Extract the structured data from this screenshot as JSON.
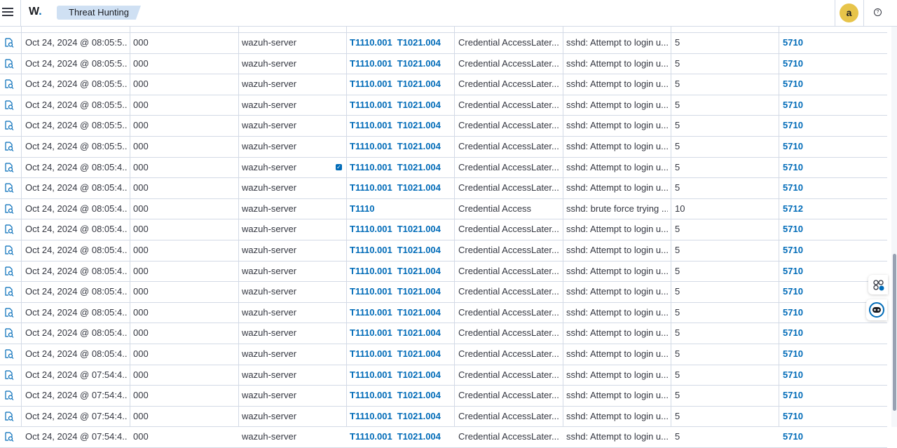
{
  "header": {
    "logo_text": "W",
    "logo_dot": ".",
    "breadcrumb": "Threat Hunting",
    "avatar_initial": "a",
    "help_symbol": "?"
  },
  "colors": {
    "link": "#006bb8",
    "avatar": "#e7c44a",
    "breadcrumb_bg": "#cfe0f3"
  },
  "table": {
    "rows": [
      {
        "time": "Oct 24, 2024 @ 08:05:5...",
        "agent": "000",
        "name": "wazuh-server",
        "techniques": [
          "T1110.001",
          "T1021.004"
        ],
        "tactic": "Credential AccessLater...",
        "description": "sshd: Attempt to login u...",
        "level": "5",
        "rule": "5710"
      },
      {
        "time": "Oct 24, 2024 @ 08:05:5...",
        "agent": "000",
        "name": "wazuh-server",
        "techniques": [
          "T1110.001",
          "T1021.004"
        ],
        "tactic": "Credential AccessLater...",
        "description": "sshd: Attempt to login u...",
        "level": "5",
        "rule": "5710"
      },
      {
        "time": "Oct 24, 2024 @ 08:05:5...",
        "agent": "000",
        "name": "wazuh-server",
        "techniques": [
          "T1110.001",
          "T1021.004"
        ],
        "tactic": "Credential AccessLater...",
        "description": "sshd: Attempt to login u...",
        "level": "5",
        "rule": "5710"
      },
      {
        "time": "Oct 24, 2024 @ 08:05:5...",
        "agent": "000",
        "name": "wazuh-server",
        "techniques": [
          "T1110.001",
          "T1021.004"
        ],
        "tactic": "Credential AccessLater...",
        "description": "sshd: Attempt to login u...",
        "level": "5",
        "rule": "5710"
      },
      {
        "time": "Oct 24, 2024 @ 08:05:5...",
        "agent": "000",
        "name": "wazuh-server",
        "techniques": [
          "T1110.001",
          "T1021.004"
        ],
        "tactic": "Credential AccessLater...",
        "description": "sshd: Attempt to login u...",
        "level": "5",
        "rule": "5710"
      },
      {
        "time": "Oct 24, 2024 @ 08:05:5...",
        "agent": "000",
        "name": "wazuh-server",
        "techniques": [
          "T1110.001",
          "T1021.004"
        ],
        "tactic": "Credential AccessLater...",
        "description": "sshd: Attempt to login u...",
        "level": "5",
        "rule": "5710"
      },
      {
        "time": "Oct 24, 2024 @ 08:05:4...",
        "agent": "000",
        "name": "wazuh-server",
        "techniques": [
          "T1110.001",
          "T1021.004"
        ],
        "tactic": "Credential AccessLater...",
        "description": "sshd: Attempt to login u...",
        "level": "5",
        "rule": "5710",
        "checked": true
      },
      {
        "time": "Oct 24, 2024 @ 08:05:4...",
        "agent": "000",
        "name": "wazuh-server",
        "techniques": [
          "T1110.001",
          "T1021.004"
        ],
        "tactic": "Credential AccessLater...",
        "description": "sshd: Attempt to login u...",
        "level": "5",
        "rule": "5710"
      },
      {
        "time": "Oct 24, 2024 @ 08:05:4...",
        "agent": "000",
        "name": "wazuh-server",
        "techniques": [
          "T1110"
        ],
        "tactic": "Credential Access",
        "description": "sshd: brute force trying ...",
        "level": "10",
        "rule": "5712"
      },
      {
        "time": "Oct 24, 2024 @ 08:05:4...",
        "agent": "000",
        "name": "wazuh-server",
        "techniques": [
          "T1110.001",
          "T1021.004"
        ],
        "tactic": "Credential AccessLater...",
        "description": "sshd: Attempt to login u...",
        "level": "5",
        "rule": "5710"
      },
      {
        "time": "Oct 24, 2024 @ 08:05:4...",
        "agent": "000",
        "name": "wazuh-server",
        "techniques": [
          "T1110.001",
          "T1021.004"
        ],
        "tactic": "Credential AccessLater...",
        "description": "sshd: Attempt to login u...",
        "level": "5",
        "rule": "5710"
      },
      {
        "time": "Oct 24, 2024 @ 08:05:4...",
        "agent": "000",
        "name": "wazuh-server",
        "techniques": [
          "T1110.001",
          "T1021.004"
        ],
        "tactic": "Credential AccessLater...",
        "description": "sshd: Attempt to login u...",
        "level": "5",
        "rule": "5710"
      },
      {
        "time": "Oct 24, 2024 @ 08:05:4...",
        "agent": "000",
        "name": "wazuh-server",
        "techniques": [
          "T1110.001",
          "T1021.004"
        ],
        "tactic": "Credential AccessLater...",
        "description": "sshd: Attempt to login u...",
        "level": "5",
        "rule": "5710"
      },
      {
        "time": "Oct 24, 2024 @ 08:05:4...",
        "agent": "000",
        "name": "wazuh-server",
        "techniques": [
          "T1110.001",
          "T1021.004"
        ],
        "tactic": "Credential AccessLater...",
        "description": "sshd: Attempt to login u...",
        "level": "5",
        "rule": "5710"
      },
      {
        "time": "Oct 24, 2024 @ 08:05:4...",
        "agent": "000",
        "name": "wazuh-server",
        "techniques": [
          "T1110.001",
          "T1021.004"
        ],
        "tactic": "Credential AccessLater...",
        "description": "sshd: Attempt to login u...",
        "level": "5",
        "rule": "5710"
      },
      {
        "time": "Oct 24, 2024 @ 08:05:4...",
        "agent": "000",
        "name": "wazuh-server",
        "techniques": [
          "T1110.001",
          "T1021.004"
        ],
        "tactic": "Credential AccessLater...",
        "description": "sshd: Attempt to login u...",
        "level": "5",
        "rule": "5710"
      },
      {
        "time": "Oct 24, 2024 @ 07:54:4...",
        "agent": "000",
        "name": "wazuh-server",
        "techniques": [
          "T1110.001",
          "T1021.004"
        ],
        "tactic": "Credential AccessLater...",
        "description": "sshd: Attempt to login u...",
        "level": "5",
        "rule": "5710"
      },
      {
        "time": "Oct 24, 2024 @ 07:54:4...",
        "agent": "000",
        "name": "wazuh-server",
        "techniques": [
          "T1110.001",
          "T1021.004"
        ],
        "tactic": "Credential AccessLater...",
        "description": "sshd: Attempt to login u...",
        "level": "5",
        "rule": "5710"
      },
      {
        "time": "Oct 24, 2024 @ 07:54:4...",
        "agent": "000",
        "name": "wazuh-server",
        "techniques": [
          "T1110.001",
          "T1021.004"
        ],
        "tactic": "Credential AccessLater...",
        "description": "sshd: Attempt to login u...",
        "level": "5",
        "rule": "5710"
      },
      {
        "time": "Oct 24, 2024 @ 07:54:4...",
        "agent": "000",
        "name": "wazuh-server",
        "techniques": [
          "T1110.001",
          "T1021.004"
        ],
        "tactic": "Credential AccessLater...",
        "description": "sshd: Attempt to login u...",
        "level": "5",
        "rule": "5710"
      }
    ]
  }
}
